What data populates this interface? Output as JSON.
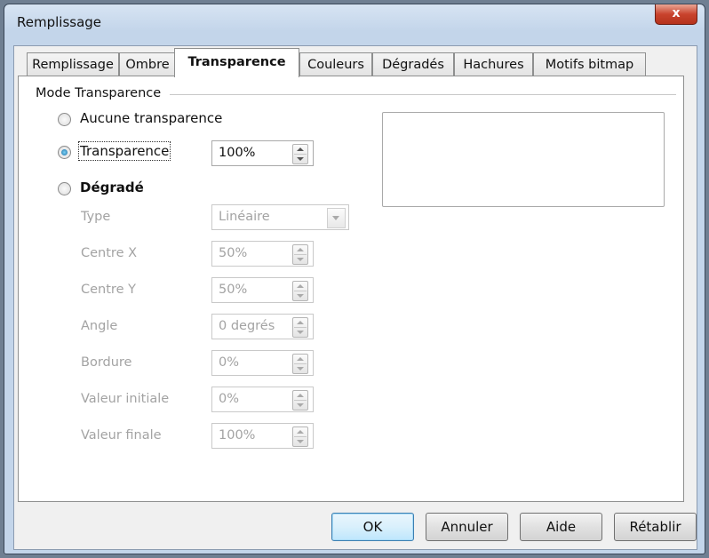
{
  "window": {
    "title": "Remplissage",
    "close_label": "x"
  },
  "tabs": [
    {
      "label": "Remplissage",
      "active": false
    },
    {
      "label": "Ombre",
      "active": false
    },
    {
      "label": "Transparence",
      "active": true
    },
    {
      "label": "Couleurs",
      "active": false
    },
    {
      "label": "Dégradés",
      "active": false
    },
    {
      "label": "Hachures",
      "active": false
    },
    {
      "label": "Motifs bitmap",
      "active": false
    }
  ],
  "group": {
    "label": "Mode Transparence"
  },
  "radios": {
    "none": {
      "label": "Aucune transparence",
      "checked": false
    },
    "transparency": {
      "label": "Transparence",
      "checked": true,
      "value": "100%"
    },
    "gradient": {
      "label": "Dégradé",
      "checked": false
    }
  },
  "gradient_fields": {
    "type": {
      "label": "Type",
      "value": "Linéaire"
    },
    "center_x": {
      "label": "Centre X",
      "value": "50%"
    },
    "center_y": {
      "label": "Centre Y",
      "value": "50%"
    },
    "angle": {
      "label": "Angle",
      "value": "0 degrés"
    },
    "border": {
      "label": "Bordure",
      "value": "0%"
    },
    "start_value": {
      "label": "Valeur initiale",
      "value": "0%"
    },
    "end_value": {
      "label": "Valeur finale",
      "value": "100%"
    }
  },
  "buttons": {
    "ok": "OK",
    "cancel": "Annuler",
    "help": "Aide",
    "reset": "Rétablir"
  },
  "colors": {
    "accent": "#3c7fb1",
    "disabled_text": "#a3a3a3",
    "close_red": "#c9432d"
  }
}
